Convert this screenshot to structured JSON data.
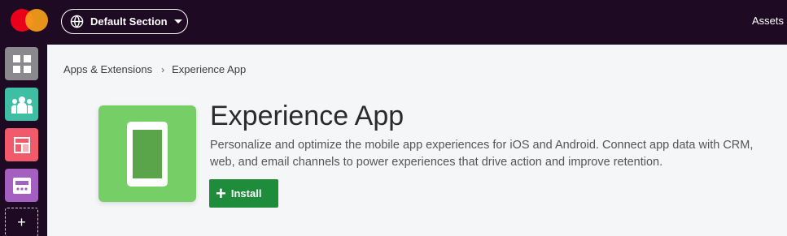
{
  "topbar": {
    "section_label": "Default Section",
    "assets_label": "Assets",
    "logo_colors": [
      "#eb001b",
      "#f79e1b"
    ]
  },
  "sidebar": {
    "items": [
      {
        "name": "dashboard",
        "icon": "grid-icon",
        "color": "#8a8a8e"
      },
      {
        "name": "audiences",
        "icon": "people-icon",
        "color": "#3ebfa3"
      },
      {
        "name": "layouts",
        "icon": "layout-icon",
        "color": "#f05a6a"
      },
      {
        "name": "app-templates",
        "icon": "app-window-icon",
        "color": "#a45fc0"
      }
    ],
    "add_label": "+"
  },
  "breadcrumb": {
    "parent": "Apps & Extensions",
    "separator": "›",
    "current": "Experience App"
  },
  "app": {
    "title": "Experience App",
    "description": "Personalize and optimize the mobile app experiences for iOS and Android. Connect app data with CRM, web, and email channels to power experiences that drive action and improve retention.",
    "install_label": "Install",
    "tile_color": "#75cf66",
    "install_color": "#1e8c3b"
  }
}
